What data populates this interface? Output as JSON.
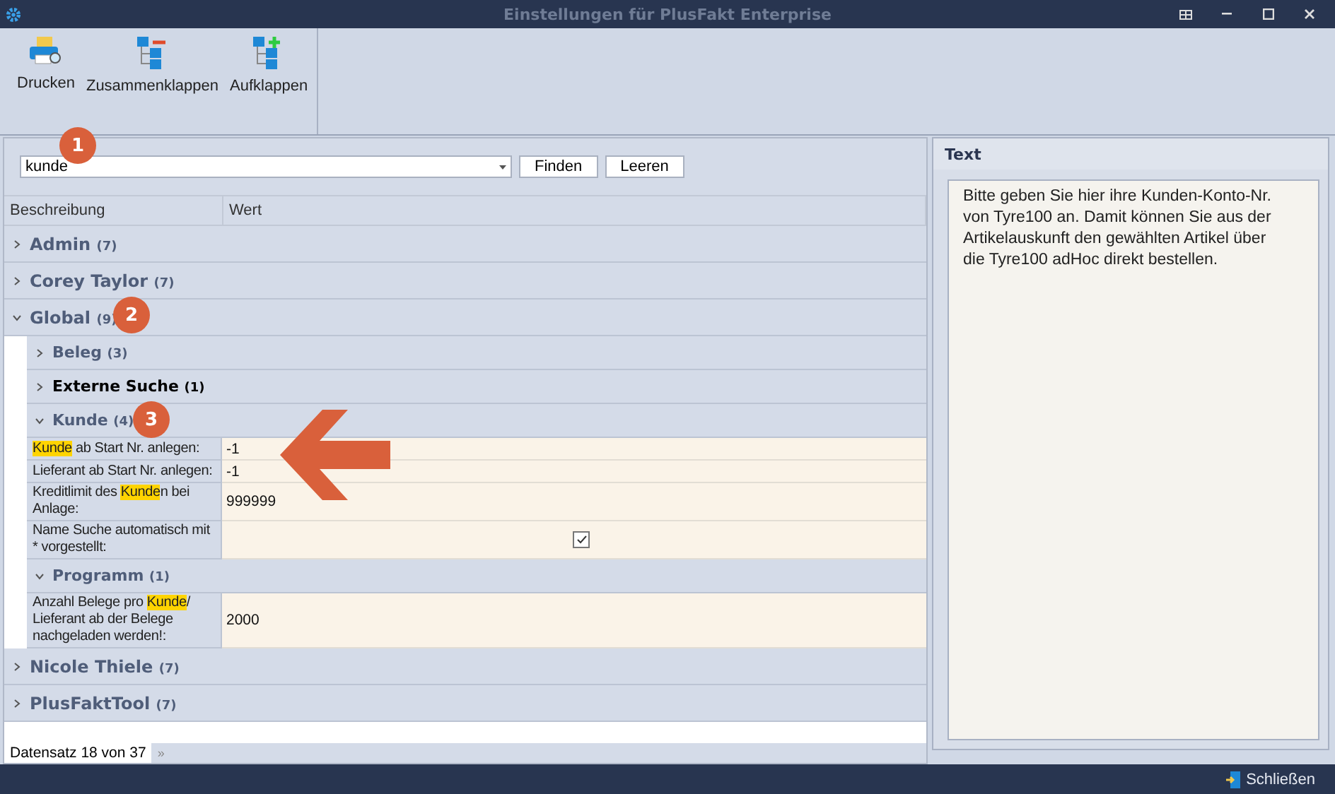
{
  "window": {
    "title": "Einstellungen für PlusFakt Enterprise"
  },
  "toolbar": [
    {
      "label": "Drucken",
      "kind": "print"
    },
    {
      "label": "Zusammenklappen",
      "kind": "collapse"
    },
    {
      "label": "Aufklappen",
      "kind": "expand"
    }
  ],
  "search": {
    "value": "kunde",
    "buttons": [
      "Finden",
      "Leeren"
    ]
  },
  "columns": [
    "Beschreibung",
    "Wert"
  ],
  "tree": [
    {
      "label": "Admin",
      "count": "(7)",
      "expanded": false,
      "selected": false
    },
    {
      "label": "Corey Taylor",
      "count": "(7)",
      "expanded": false,
      "selected": false
    },
    {
      "label": "Global",
      "count": "(9)",
      "expanded": true,
      "selected": false,
      "children": [
        {
          "label": "Beleg",
          "count": "(3)",
          "expanded": false,
          "selected": false
        },
        {
          "label": "Externe Suche",
          "count": "(1)",
          "expanded": false,
          "selected": true
        },
        {
          "label": "Kunde",
          "count": "(4)",
          "expanded": true,
          "selected": false,
          "children": [
            {
              "kind": "text",
              "parts": [
                {
                  "text": "Kunde",
                  "highlight": true
                },
                {
                  "text": " ab Start Nr. anlegen:",
                  "highlight": false
                }
              ],
              "value": "-1"
            },
            {
              "kind": "text",
              "parts": [
                {
                  "text": "Lieferant ab Start Nr. anlegen:",
                  "highlight": false
                }
              ],
              "value": "-1"
            },
            {
              "kind": "text",
              "parts": [
                {
                  "text": "Kreditlimit des ",
                  "highlight": false
                },
                {
                  "text": "Kunde",
                  "highlight": true
                },
                {
                  "text": "n bei Anlage:",
                  "highlight": false
                }
              ],
              "value": "999999"
            },
            {
              "kind": "checkbox",
              "parts": [
                {
                  "text": "Name Suche automatisch mit * vorgestellt:",
                  "highlight": false
                }
              ],
              "checked": true
            }
          ]
        },
        {
          "label": "Programm",
          "count": "(1)",
          "expanded": true,
          "selected": false,
          "children": [
            {
              "kind": "text",
              "parts": [
                {
                  "text": "Anzahl Belege pro ",
                  "highlight": false
                },
                {
                  "text": "Kunde",
                  "highlight": true
                },
                {
                  "text": "/ Lieferant ab der Belege nachgeladen werden!:",
                  "highlight": false
                }
              ],
              "value": "2000"
            }
          ]
        }
      ]
    },
    {
      "label": "Nicole Thiele",
      "count": "(7)",
      "expanded": false,
      "selected": false
    },
    {
      "label": "PlusFaktTool",
      "count": "(7)",
      "expanded": false,
      "selected": false
    }
  ],
  "footer": {
    "record": "Datensatz 18 von 37",
    "nav": "»"
  },
  "text_panel": {
    "title": "Text",
    "body": "Bitte geben Sie hier ihre Kunden-Konto-Nr. von Tyre100 an. Damit können Sie aus der Artikelauskunft den gewählten Artikel über die Tyre100 adHoc direkt bestellen."
  },
  "status_bar": {
    "close": "Schließen"
  },
  "annotations": [
    {
      "label": "1"
    },
    {
      "label": "2"
    },
    {
      "label": "3"
    }
  ]
}
